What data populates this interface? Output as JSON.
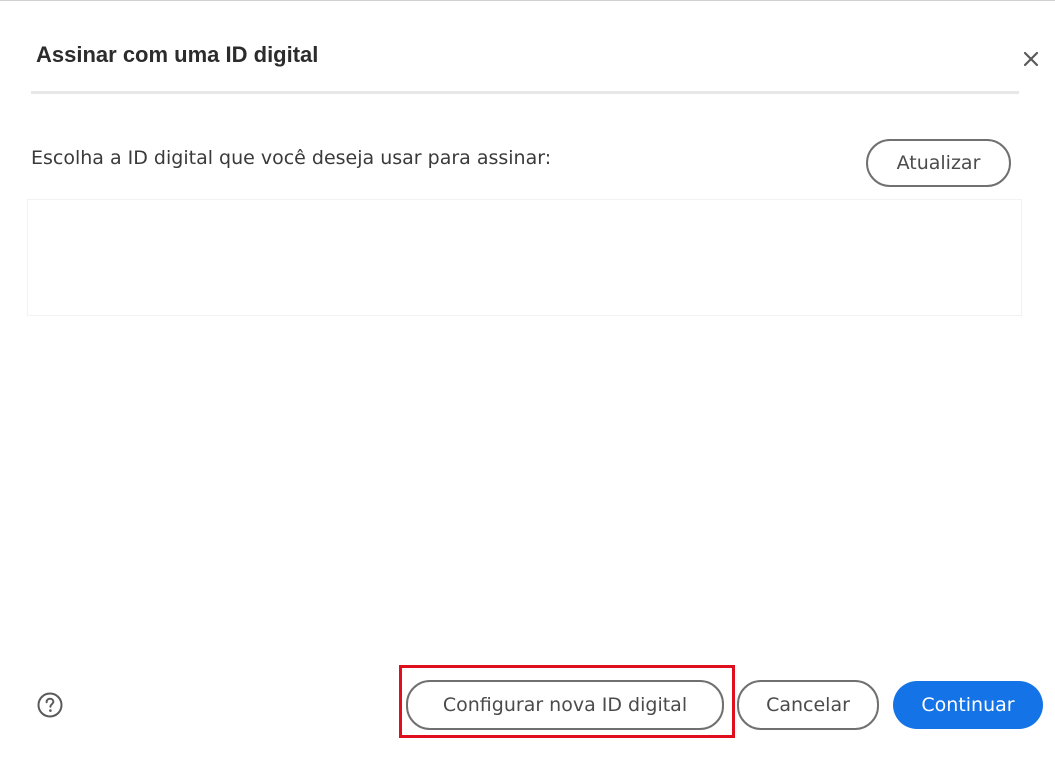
{
  "dialog": {
    "title": "Assinar com uma ID digital",
    "close_icon": "close-icon"
  },
  "content": {
    "prompt": "Escolha a ID digital que você deseja usar para assinar:",
    "refresh_label": "Atualizar",
    "digital_ids": []
  },
  "footer": {
    "help_icon": "help-circle-icon",
    "setup_label": "Configurar nova ID digital",
    "cancel_label": "Cancelar",
    "continue_label": "Continuar"
  },
  "colors": {
    "primary_button": "#1473e6",
    "highlight": "#e00f1e",
    "divider": "#e8e8e8"
  }
}
